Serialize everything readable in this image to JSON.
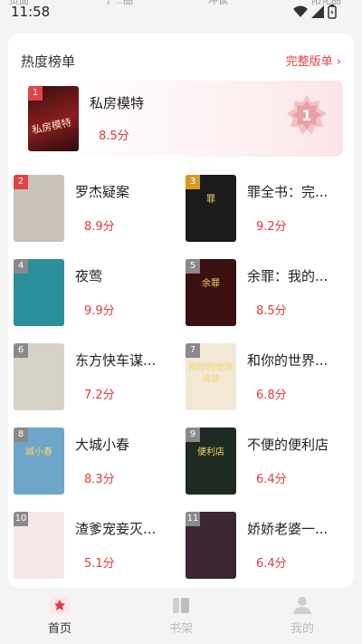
{
  "status": {
    "time": "11:58",
    "clipped_texts": [
      "页面",
      "广..品",
      "冲读",
      "阳化品"
    ]
  },
  "card": {
    "title": "热度榜单",
    "more_label": "完整版单",
    "more_icon": "chevron-right-icon"
  },
  "featured": {
    "rank": "1",
    "title": "私房模特",
    "score": "8.5分",
    "badge": "1",
    "cover_text": "私房模特"
  },
  "books": [
    {
      "rank": "2",
      "title": "罗杰疑案",
      "score": "8.9分",
      "cover_color": "#c8c2b8",
      "rank_color": "#e04444"
    },
    {
      "rank": "3",
      "title": "罪全书：完...",
      "score": "9.2分",
      "cover_color": "#1b1b1b",
      "rank_color": "#d89b22",
      "cover_text": "罪"
    },
    {
      "rank": "4",
      "title": "夜莺",
      "score": "9.9分",
      "cover_color": "#2a8f9a",
      "rank_color": "#8a8a8a"
    },
    {
      "rank": "5",
      "title": "余罪：我的...",
      "score": "8.5分",
      "cover_color": "#3a1010",
      "rank_color": "#8a8a8a",
      "cover_text": "余罪"
    },
    {
      "rank": "6",
      "title": "东方快车谋...",
      "score": "7.2分",
      "cover_color": "#d7d2c8",
      "rank_color": "#8a8a8a"
    },
    {
      "rank": "7",
      "title": "和你的世界...",
      "score": "6.8分",
      "cover_color": "#f1e8d6",
      "rank_color": "#8a8a8a",
      "cover_text": "和你的世界谈谈"
    },
    {
      "rank": "8",
      "title": "大城小春",
      "score": "8.3分",
      "cover_color": "#6fa5c8",
      "rank_color": "#8a8a8a",
      "cover_text": "城小春"
    },
    {
      "rank": "9",
      "title": "不便的便利店",
      "score": "6.4分",
      "cover_color": "#1f2a22",
      "rank_color": "#8a8a8a",
      "cover_text": "便利店"
    },
    {
      "rank": "10",
      "title": "渣爹宠妾灭...",
      "score": "5.1分",
      "cover_color": "#f4e7e6",
      "rank_color": "#8a8a8a"
    },
    {
      "rank": "11",
      "title": "娇娇老婆一...",
      "score": "6.4分",
      "cover_color": "#3b2634",
      "rank_color": "#8a8a8a"
    }
  ],
  "tabs": [
    {
      "label": "首页",
      "icon": "home-icon",
      "active": true,
      "color": "#333333"
    },
    {
      "label": "书架",
      "icon": "bookshelf-icon",
      "active": false,
      "color": "#bbbbbb"
    },
    {
      "label": "我的",
      "icon": "profile-icon",
      "active": false,
      "color": "#bbbbbb"
    }
  ],
  "colors": {
    "accent": "#e23b3b",
    "background": "#f4f4f4",
    "card": "#ffffff"
  }
}
